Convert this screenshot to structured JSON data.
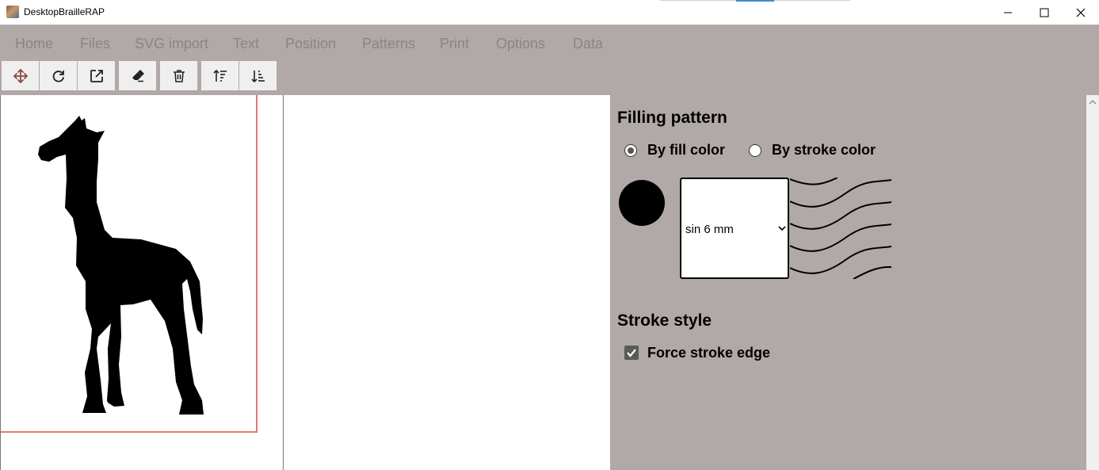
{
  "window": {
    "title": "DesktopBrailleRAP",
    "icons": {
      "app": "app-icon",
      "minimize": "minimize-icon",
      "maximize": "maximize-icon",
      "close": "close-icon"
    }
  },
  "menu": {
    "items": [
      "Home",
      "Files",
      "SVG import",
      "Text",
      "Position",
      "Patterns",
      "Print",
      "Options",
      "Data"
    ]
  },
  "toolbar": {
    "buttons": [
      "move-icon",
      "rotate-icon",
      "external-open-icon",
      "eraser-icon",
      "trash-icon",
      "sort-ascending-icon",
      "sort-descending-icon"
    ]
  },
  "canvas": {
    "shape": "giraffe-silhouette",
    "shape_fill": "#000000",
    "page_border_color": "#e07a72"
  },
  "panel": {
    "filling_heading": "Filling pattern",
    "mode_options": [
      {
        "label": "By fill color",
        "checked": true
      },
      {
        "label": "By stroke color",
        "checked": false
      }
    ],
    "selected_color": "#000000",
    "pattern_value": "sin 6 mm",
    "stroke_heading": "Stroke style",
    "force_stroke_label": "Force stroke edge",
    "force_stroke_checked": true
  },
  "colors": {
    "chrome": "#b1a9a7",
    "menu_text": "#8b8483",
    "button_bg": "#f0efef"
  }
}
